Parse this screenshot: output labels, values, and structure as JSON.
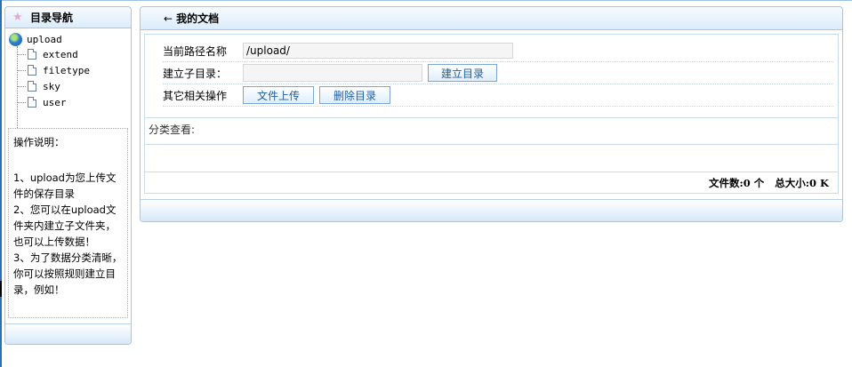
{
  "nav": {
    "title": "目录导航",
    "root": "upload",
    "items": [
      {
        "label": "extend"
      },
      {
        "label": "filetype"
      },
      {
        "label": "sky"
      },
      {
        "label": "user"
      }
    ]
  },
  "help": {
    "title": "操作说明：",
    "line1": "1、upload为您上传文件的保存目录",
    "line2": "2、您可以在upload文件夹内建立子文件夹，也可以上传数据！",
    "line3": "3、为了数据分类清晰，你可以按照规则建立目录，例如！"
  },
  "main": {
    "title": "我的文档",
    "back_icon": "left-arrow",
    "form": {
      "path_label": "当前路径名称",
      "path_value": "/upload/",
      "newdir_label": "建立子目录：",
      "newdir_value": "",
      "create_button": "建立目录",
      "other_label": "其它相关操作",
      "upload_button": "文件上传",
      "delete_button": "删除目录"
    },
    "category_label": "分类查看:",
    "summary": {
      "file_count": "文件数:0 个",
      "total_size": "总大小:0 K"
    }
  },
  "colors": {
    "border": "#a5c7e6",
    "button_text": "#1e5e9e",
    "header_grad_end": "#dcecfa"
  }
}
